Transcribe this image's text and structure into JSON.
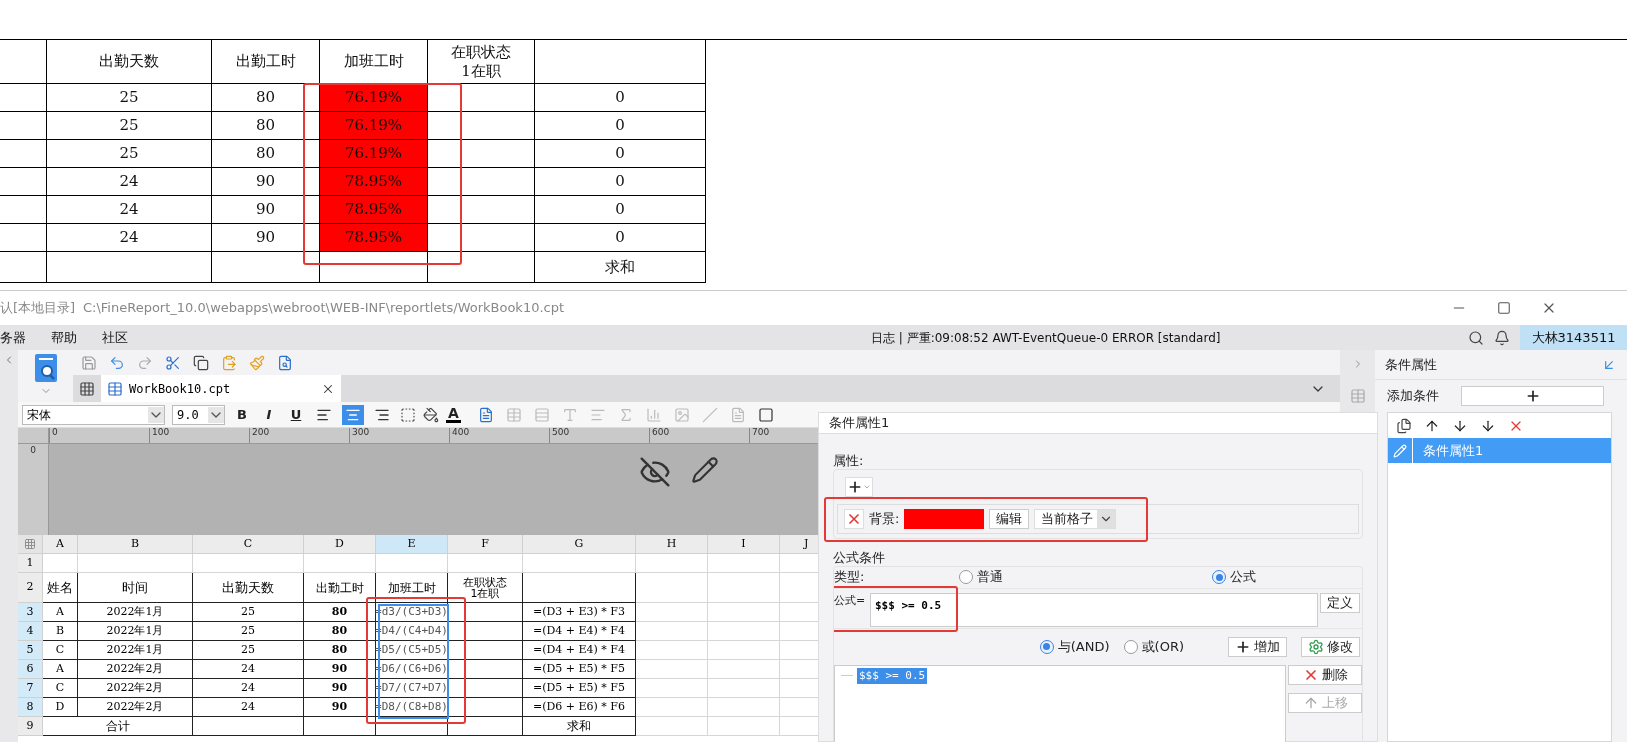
{
  "preview_table": {
    "headers": [
      [
        "出勤天数"
      ],
      [
        "出勤工时"
      ],
      [
        "加班工时"
      ],
      [
        "在职状态",
        "1在职"
      ]
    ],
    "rows": [
      {
        "days": "25",
        "hours": "80",
        "overtime": "76.19%",
        "column_6": "0",
        "highlighted": true
      },
      {
        "days": "25",
        "hours": "80",
        "overtime": "76.19%",
        "column_6": "0",
        "highlighted": true
      },
      {
        "days": "25",
        "hours": "80",
        "overtime": "76.19%",
        "column_6": "0",
        "highlighted": true
      },
      {
        "days": "24",
        "hours": "90",
        "overtime": "78.95%",
        "column_6": "0",
        "highlighted": true
      },
      {
        "days": "24",
        "hours": "90",
        "overtime": "78.95%",
        "column_6": "0",
        "highlighted": true
      },
      {
        "days": "24",
        "hours": "90",
        "overtime": "78.95%",
        "column_6": "0",
        "highlighted": true
      }
    ],
    "footer": {
      "column_6": "求和"
    }
  },
  "title_bar": {
    "location": "认[本地目录]",
    "path": "C:\\FineReport_10.0\\webapps\\webroot\\WEB-INF\\reportlets/WorkBook10.cpt"
  },
  "menu": [
    "务器",
    "帮助",
    "社区"
  ],
  "log": "日志 | 严重:09:08:52 AWT-EventQueue-0 ERROR [standard]",
  "user": "大林3143511",
  "file_tab": "WorkBook10.cpt",
  "format_toolbar": {
    "font": "宋体",
    "size": "9.0",
    "styles": [
      "B",
      "I",
      "U"
    ],
    "alignments": [
      {
        "kind": "left",
        "selected": false
      },
      {
        "kind": "center",
        "selected": true
      },
      {
        "kind": "right",
        "selected": false
      }
    ],
    "font_color": "A"
  },
  "ruler": [
    "0",
    "100",
    "200",
    "300",
    "400",
    "500",
    "600",
    "700"
  ],
  "vertical_ruler": "0",
  "sheet": {
    "columns": [
      {
        "label": "A",
        "selected": false
      },
      {
        "label": "B",
        "selected": false
      },
      {
        "label": "C",
        "selected": false
      },
      {
        "label": "D",
        "selected": false
      },
      {
        "label": "E",
        "selected": true
      },
      {
        "label": "F",
        "selected": false
      },
      {
        "label": "G",
        "selected": false
      },
      {
        "label": "H",
        "selected": false
      },
      {
        "label": "I",
        "selected": false
      },
      {
        "label": "J",
        "selected": false
      }
    ],
    "row_numbers": [
      {
        "label": "1",
        "selected": false
      },
      {
        "label": "2",
        "selected": false
      },
      {
        "label": "3",
        "selected": true
      },
      {
        "label": "4",
        "selected": true
      },
      {
        "label": "5",
        "selected": true
      },
      {
        "label": "6",
        "selected": true
      },
      {
        "label": "7",
        "selected": true
      },
      {
        "label": "8",
        "selected": true
      },
      {
        "label": "9",
        "selected": false
      }
    ],
    "header": {
      "name": "姓名",
      "time": "时间",
      "days": "出勤天数",
      "hours": "出勤工时",
      "overtime": "加班工时",
      "status": [
        "在职状态",
        "1在职"
      ]
    },
    "rows": [
      {
        "name": "A",
        "time": "2022年1月",
        "days": "25",
        "hours": "80",
        "overtime": "=d3/(C3+D3)",
        "total": "=(D3 + E3) * F3"
      },
      {
        "name": "B",
        "time": "2022年1月",
        "days": "25",
        "hours": "80",
        "overtime": "=D4/(C4+D4)",
        "total": "=(D4 + E4) * F4"
      },
      {
        "name": "C",
        "time": "2022年1月",
        "days": "25",
        "hours": "80",
        "overtime": "=D5/(C5+D5)",
        "total": "=(D4 + E4) * F4"
      },
      {
        "name": "A",
        "time": "2022年2月",
        "days": "24",
        "hours": "90",
        "overtime": "=D6/(C6+D6)",
        "total": "=(D5 + E5) * F5"
      },
      {
        "name": "C",
        "time": "2022年2月",
        "days": "24",
        "hours": "90",
        "overtime": "=D7/(C7+D7)",
        "total": "=(D5 + E5) * F5"
      },
      {
        "name": "D",
        "time": "2022年2月",
        "days": "24",
        "hours": "90",
        "overtime": "=D8/(C8+D8)",
        "total": "=(D6 + E6) * F6"
      }
    ],
    "footer": {
      "label": "合计",
      "total": "求和"
    }
  },
  "panel": {
    "title": "条件属性",
    "add_label": "添加条件",
    "items": [
      {
        "label": "条件属性1",
        "selected": true
      }
    ]
  },
  "dialog": {
    "title": "条件属性1",
    "properties_label": "属性:",
    "background_label": "背景:",
    "edit_button": "编辑",
    "scope": "当前格子",
    "formula_group": "公式条件",
    "type_label": "类型:",
    "types": [
      {
        "label": "普通",
        "selected": false
      },
      {
        "label": "公式",
        "selected": true
      }
    ],
    "formula_label": "公式=",
    "formula": "$$$ >= 0.5",
    "define_button": "定义",
    "logic": [
      {
        "label": "与(AND)",
        "selected": true
      },
      {
        "label": "或(OR)",
        "selected": false
      }
    ],
    "add_button": "增加",
    "modify_button": "修改",
    "conditions": [
      {
        "label": "$$$ >= 0.5",
        "selected": true
      }
    ],
    "delete_button": "删除",
    "move_up": {
      "label": "上移",
      "disabled": true
    }
  }
}
